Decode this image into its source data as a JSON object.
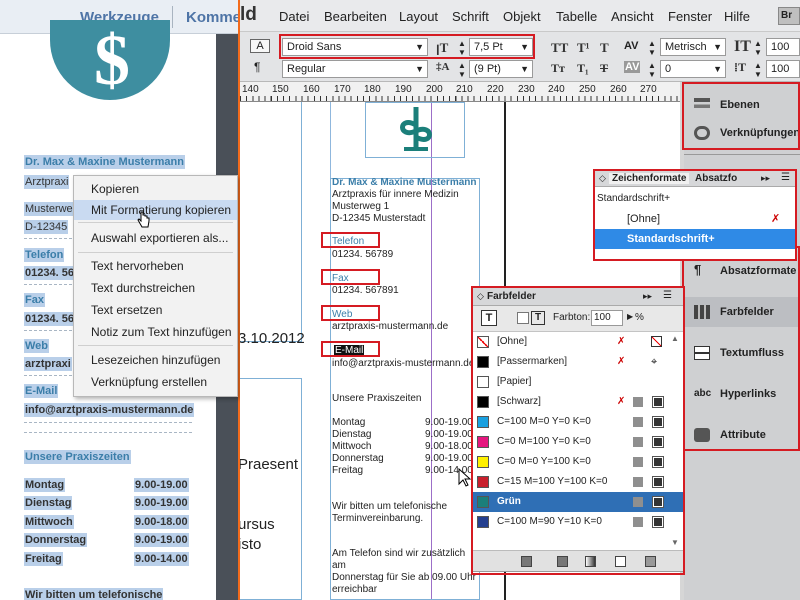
{
  "left_panel": {
    "header_tabs": [
      "Werkzeuge",
      "Kommen"
    ],
    "address": [
      "Dr. Max & Maxine Mustermann",
      "Arztpraxi",
      "Musterwe",
      "D-12345"
    ],
    "telefon_label": "Telefon",
    "telefon": "01234. 56",
    "fax_label": "Fax",
    "fax": "01234. 56",
    "web_label": "Web",
    "web": "arztpraxi",
    "email_label": "E-Mail",
    "email": "info@arztpraxis-mustermann.de",
    "hours_title": "Unsere Praxiszeiten",
    "hours": [
      {
        "day": "Montag",
        "time": "9.00-19.00"
      },
      {
        "day": "Dienstag",
        "time": "9.00-19.00"
      },
      {
        "day": "Mittwoch",
        "time": "9.00-18.00"
      },
      {
        "day": "Donnerstag",
        "time": "9.00-19.00"
      },
      {
        "day": "Freitag",
        "time": "9.00-14.00"
      }
    ],
    "footer_cut": "Wir bitten um telefonische"
  },
  "context_menu": {
    "items": [
      "Kopieren",
      "Mit Formatierung kopieren",
      "Auswahl exportieren als...",
      "Text hervorheben",
      "Text durchstreichen",
      "Text ersetzen",
      "Notiz zum Text hinzufügen",
      "Lesezeichen hinzufügen",
      "Verknüpfung erstellen"
    ],
    "highlighted": 1
  },
  "menubar": {
    "app_fragment": "ld",
    "items": [
      "Datei",
      "Bearbeiten",
      "Layout",
      "Schrift",
      "Objekt",
      "Tabelle",
      "Ansicht",
      "Fenster",
      "Hilfe"
    ],
    "bridge": "Br"
  },
  "control_panel": {
    "font": "Droid Sans",
    "style": "Regular",
    "size": "7,5 Pt",
    "leading": "(9 Pt)",
    "kerning": "Metrisch",
    "tracking": "0",
    "hscale": "100",
    "vscale": "100"
  },
  "ruler": {
    "numbers": [
      "140",
      "150",
      "160",
      "170",
      "180",
      "190",
      "200",
      "210",
      "220",
      "230",
      "240",
      "250",
      "260",
      "270"
    ]
  },
  "canvas": {
    "date_fragment": "3.10.2012",
    "praesent": "Praesent",
    "ursus": "ursus",
    "isto": "isto",
    "address": [
      "Dr. Max & Maxine Mustermann",
      "Arztpraxis für innere Medizin",
      "Musterweg 1",
      "D-12345 Musterstadt"
    ],
    "telefon_label": "Telefon",
    "telefon": "01234. 56789",
    "fax_label": "Fax",
    "fax": "01234. 567891",
    "web_label": "Web",
    "web": "arztpraxis-mustermann.de",
    "email_label": "E-Mail",
    "email": "info@arztpraxis-mustermann.de",
    "hours_title": "Unsere Praxiszeiten",
    "hours": [
      {
        "day": "Montag",
        "time": "9.00-19.00"
      },
      {
        "day": "Dienstag",
        "time": "9.00-19.00"
      },
      {
        "day": "Mittwoch",
        "time": "9.00-18.00"
      },
      {
        "day": "Donnerstag",
        "time": "9.00-19.00"
      },
      {
        "day": "Freitag",
        "time": "9.00-14.00"
      }
    ],
    "note": [
      "Wir bitten um telefonische",
      "Terminvereinbarung."
    ],
    "phone_note": [
      "Am Telefon sind wir zusätzlich",
      "am",
      "Donnerstag für Sie ab 09.00 Uhr",
      "erreichbar"
    ]
  },
  "right_panel": {
    "items": [
      "Ebenen",
      "Verknüpfungen",
      "Absatzformate",
      "Farbfelder",
      "Textumfluss",
      "Hyperlinks",
      "Attribute"
    ]
  },
  "zeichenformate": {
    "tabs": [
      "Zeichenformate",
      "Absatzfo"
    ],
    "current": "Standardschrift+",
    "rows": [
      "[Ohne]",
      "Standardschrift+"
    ]
  },
  "farbfelder": {
    "title": "Farbfelder",
    "tint_label": "Farbton:",
    "tint": "100",
    "percent": "%",
    "swatches": [
      {
        "name": "[Ohne]",
        "color": "#ffffff"
      },
      {
        "name": "[Passermarken]",
        "color": "#000000"
      },
      {
        "name": "[Papier]",
        "color": "#ffffff"
      },
      {
        "name": "[Schwarz]",
        "color": "#000000"
      },
      {
        "name": "C=100 M=0 Y=0 K=0",
        "color": "#1aa0e0"
      },
      {
        "name": "C=0 M=100 Y=0 K=0",
        "color": "#e5177f"
      },
      {
        "name": "C=0 M=0 Y=100 K=0",
        "color": "#fff000"
      },
      {
        "name": "C=15 M=100 Y=100 K=0",
        "color": "#c8202d"
      },
      {
        "name": "Grün",
        "color": "#1b7f7a"
      },
      {
        "name": "C=100 M=90 Y=10 K=0",
        "color": "#243f8f"
      }
    ],
    "selected": 8
  }
}
